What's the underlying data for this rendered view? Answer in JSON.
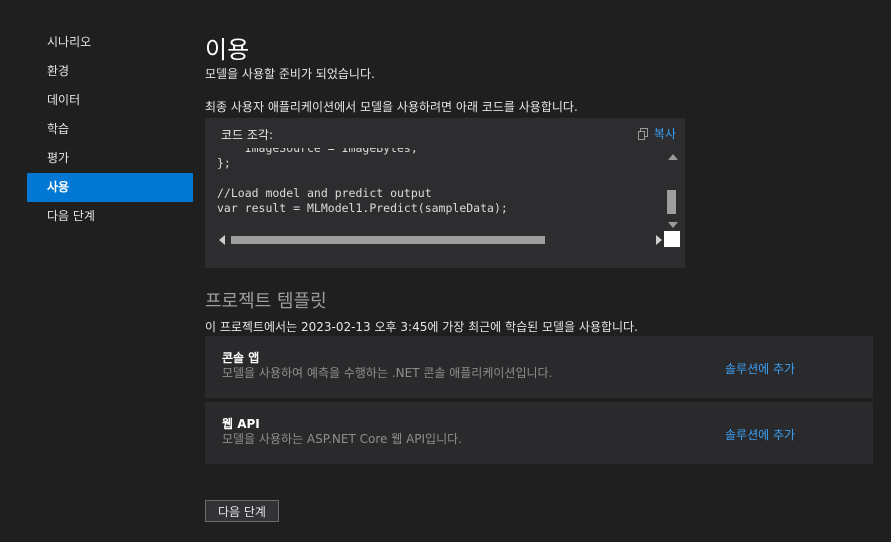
{
  "sidebar": {
    "items": [
      {
        "label": "시나리오",
        "active": false
      },
      {
        "label": "환경",
        "active": false
      },
      {
        "label": "데이터",
        "active": false
      },
      {
        "label": "학습",
        "active": false
      },
      {
        "label": "평가",
        "active": false
      },
      {
        "label": "사용",
        "active": true
      },
      {
        "label": "다음 단계",
        "active": false
      }
    ]
  },
  "main": {
    "title": "이용",
    "subtitle": "모델을 사용할 준비가 되었습니다.",
    "code_intro": "최종 사용자 애플리케이션에서 모델을 사용하려면 아래 코드를 사용합니다.",
    "code_panel": {
      "header": "코드 조각:",
      "copy_label": "복사",
      "copy_icon": "copy-icon",
      "lines": [
        "    ImageSource = ImageBytes,",
        "};",
        "",
        "//Load model and predict output",
        "var result = MLModel1.Predict(sampleData);"
      ]
    },
    "templates": {
      "title": "프로젝트 템플릿",
      "description": "이 프로젝트에서는 2023-02-13 오후 3:45에 가장 최근에 학습된 모델을 사용합니다.",
      "cards": [
        {
          "title": "콘솔 앱",
          "description": "모델을 사용하여 예측을 수행하는 .NET 콘솔 애플리케이션입니다.",
          "action": "솔루션에 추가"
        },
        {
          "title": "웹 API",
          "description": "모델을 사용하는 ASP.NET Core 웹 API입니다.",
          "action": "솔루션에 추가"
        }
      ]
    },
    "next_button": "다음 단계"
  },
  "colors": {
    "background": "#1f1f1f",
    "panel": "#2d2d30",
    "accent": "#0078d4",
    "link": "#3aa0f3"
  }
}
